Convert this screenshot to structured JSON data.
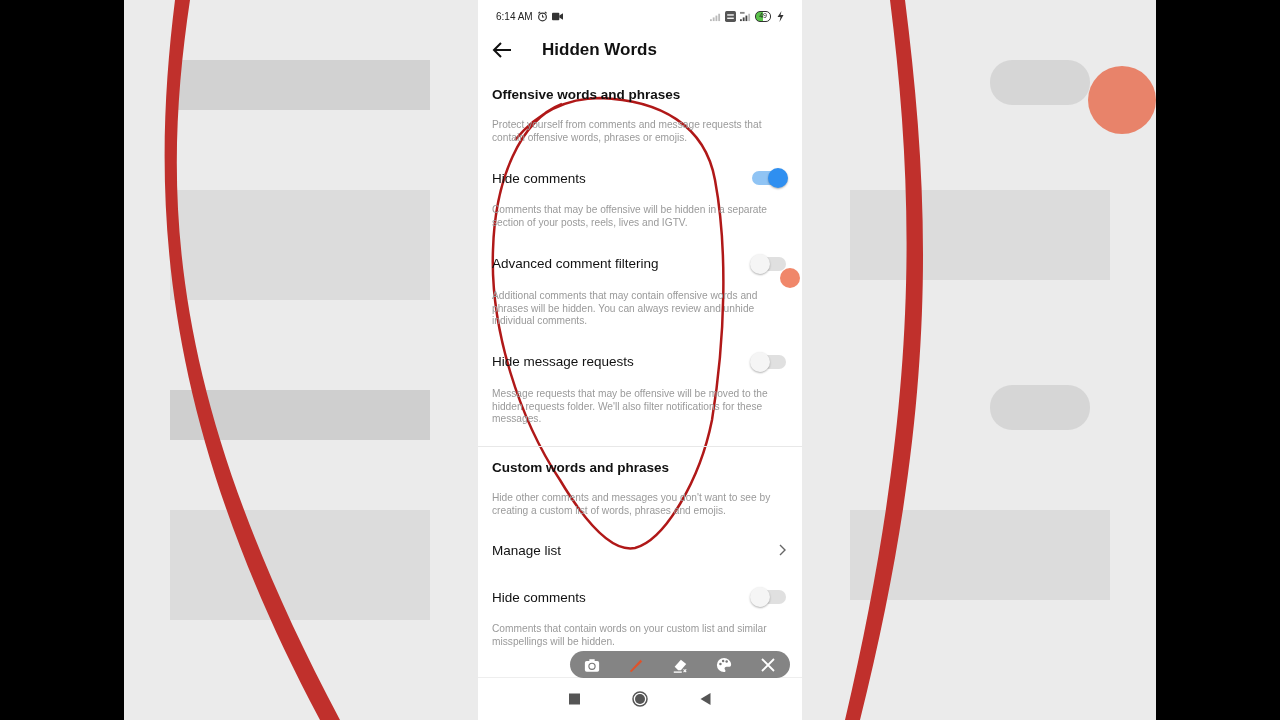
{
  "status_bar": {
    "time": "6:14 AM",
    "battery": "49"
  },
  "header": {
    "title": "Hidden Words"
  },
  "sections": [
    {
      "title": "Offensive words and phrases",
      "description": "Protect yourself from comments and message requests that contain offensive words, phrases or emojis.",
      "items": [
        {
          "kind": "toggle",
          "label": "Hide comments",
          "on": true,
          "description": "Comments that may be offensive will be hidden in a separate section of your posts, reels, lives and IGTV."
        },
        {
          "kind": "toggle",
          "label": "Advanced comment filtering",
          "on": false,
          "description": "Additional comments that may contain offensive words and phrases will be hidden. You can always review and unhide individual comments."
        },
        {
          "kind": "toggle",
          "label": "Hide message requests",
          "on": false,
          "description": "Message requests that may be offensive will be moved to the hidden requests folder. We'll also filter notifications for these messages."
        }
      ]
    },
    {
      "title": "Custom words and phrases",
      "description": "Hide other comments and messages you don't want to see by creating a custom list of words, phrases and emojis.",
      "items": [
        {
          "kind": "link",
          "label": "Manage list"
        },
        {
          "kind": "toggle",
          "label": "Hide comments",
          "on": false,
          "description": "Comments that contain words on your custom list and similar misspellings will be hidden."
        }
      ]
    }
  ]
}
